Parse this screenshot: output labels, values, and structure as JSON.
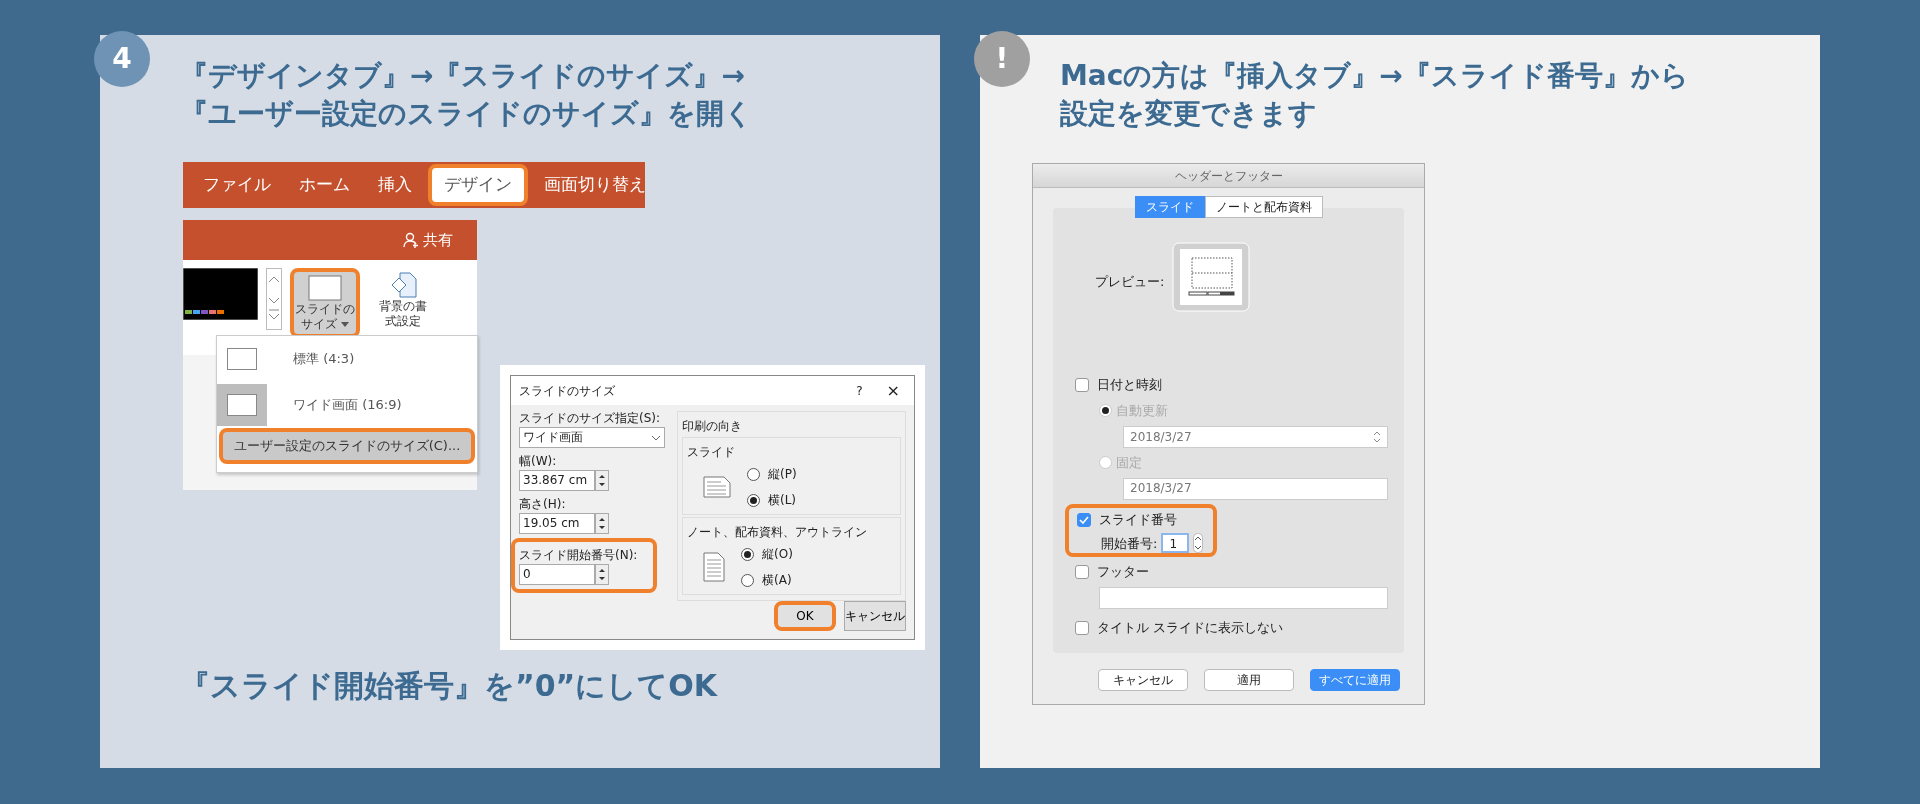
{
  "step": {
    "badge": "4",
    "heading": [
      "『デザインタブ』→『スライドのサイズ』→",
      "『ユーザー設定のスライドのサイズ』を開く"
    ],
    "ribbon": {
      "tabs": [
        {
          "label": "ファイル",
          "selected": false,
          "highlighted": false
        },
        {
          "label": "ホーム",
          "selected": false,
          "highlighted": false
        },
        {
          "label": "挿入",
          "selected": false,
          "highlighted": false
        },
        {
          "label": "デザイン",
          "selected": true,
          "highlighted": true
        },
        {
          "label": "画面切り替え",
          "selected": false,
          "highlighted": false
        }
      ],
      "share": "共有",
      "buttons": [
        {
          "lines": [
            "スライドの",
            "サイズ"
          ],
          "dropdown": true,
          "highlighted": true
        },
        {
          "lines": [
            "背景の書",
            "式設定"
          ],
          "dropdown": false,
          "highlighted": false
        }
      ],
      "menu": [
        {
          "label": "標準 (4:3)",
          "kind": "size",
          "selected": false,
          "highlighted": false
        },
        {
          "label": "ワイド画面 (16:9)",
          "kind": "size",
          "selected": true,
          "highlighted": false
        },
        {
          "label": "ユーザー設定のスライドのサイズ(C)...",
          "kind": "command",
          "selected": false,
          "highlighted": true
        }
      ]
    },
    "dialog": {
      "title": "スライドのサイズ",
      "help": "?",
      "close": "×",
      "size_label": "スライドのサイズ指定(S):",
      "size_value": "ワイド画面",
      "width_label": "幅(W):",
      "width_value": "33.867 cm",
      "height_label": "高さ(H):",
      "height_value": "19.05 cm",
      "start_label": "スライド開始番号(N):",
      "start_value": "0",
      "start_highlighted": true,
      "orientation_title": "印刷の向き",
      "groups": [
        {
          "title": "スライド",
          "kind": "landscape",
          "options": [
            {
              "label": "縦(P)",
              "selected": false
            },
            {
              "label": "横(L)",
              "selected": true
            }
          ]
        },
        {
          "title": "ノート、配布資料、アウトライン",
          "kind": "portrait",
          "options": [
            {
              "label": "縦(O)",
              "selected": true
            },
            {
              "label": "横(A)",
              "selected": false
            }
          ]
        }
      ],
      "buttons": [
        {
          "label": "OK",
          "highlighted": true
        },
        {
          "label": "キャンセル",
          "highlighted": false
        }
      ]
    },
    "caption": "『スライド開始番号』を”0”にしてOK"
  },
  "note": {
    "badge": "!",
    "heading": [
      "Macの方は『挿入タブ』→『スライド番号』から",
      "設定を変更できます"
    ],
    "dialog": {
      "title": "ヘッダーとフッター",
      "tabs": [
        {
          "label": "スライド",
          "selected": true
        },
        {
          "label": "ノートと配布資料",
          "selected": false
        }
      ],
      "preview_label": "プレビュー:",
      "date": {
        "label": "日付と時刻",
        "checked": false
      },
      "auto": {
        "label": "自動更新",
        "selected": true,
        "disabled": true
      },
      "auto_value": "2018/3/27",
      "fixed": {
        "label": "固定",
        "selected": false,
        "disabled": true
      },
      "fixed_value": "2018/3/27",
      "slide_number": {
        "label": "スライド番号",
        "checked": true,
        "highlighted": true
      },
      "start_label": "開始番号:",
      "start_value": "1",
      "footer": {
        "label": "フッター",
        "checked": false
      },
      "hide_title": {
        "label": "タイトル スライドに表示しない",
        "checked": false
      },
      "buttons": [
        {
          "label": "キャンセル",
          "kind": "normal"
        },
        {
          "label": "適用",
          "kind": "normal"
        },
        {
          "label": "すべてに適用",
          "kind": "default"
        }
      ]
    }
  }
}
